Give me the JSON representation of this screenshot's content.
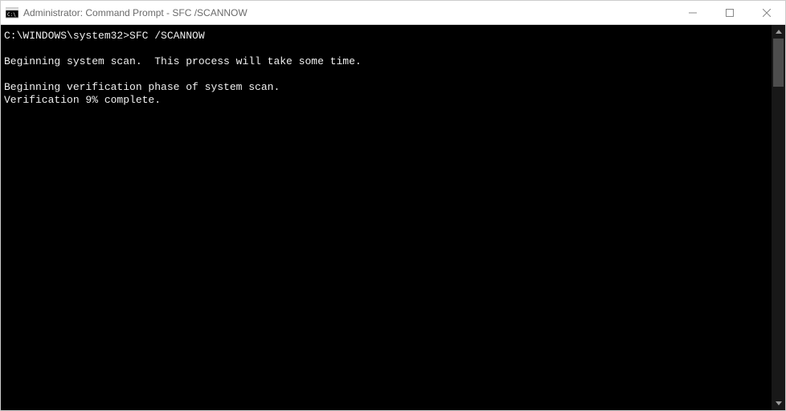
{
  "titlebar": {
    "title": "Administrator: Command Prompt - SFC  /SCANNOW"
  },
  "terminal": {
    "prompt_path": "C:\\WINDOWS\\system32>",
    "prompt_command": "SFC /SCANNOW",
    "lines": {
      "l1": "Beginning system scan.  This process will take some time.",
      "l2": "Beginning verification phase of system scan.",
      "l3": "Verification 9% complete."
    }
  }
}
